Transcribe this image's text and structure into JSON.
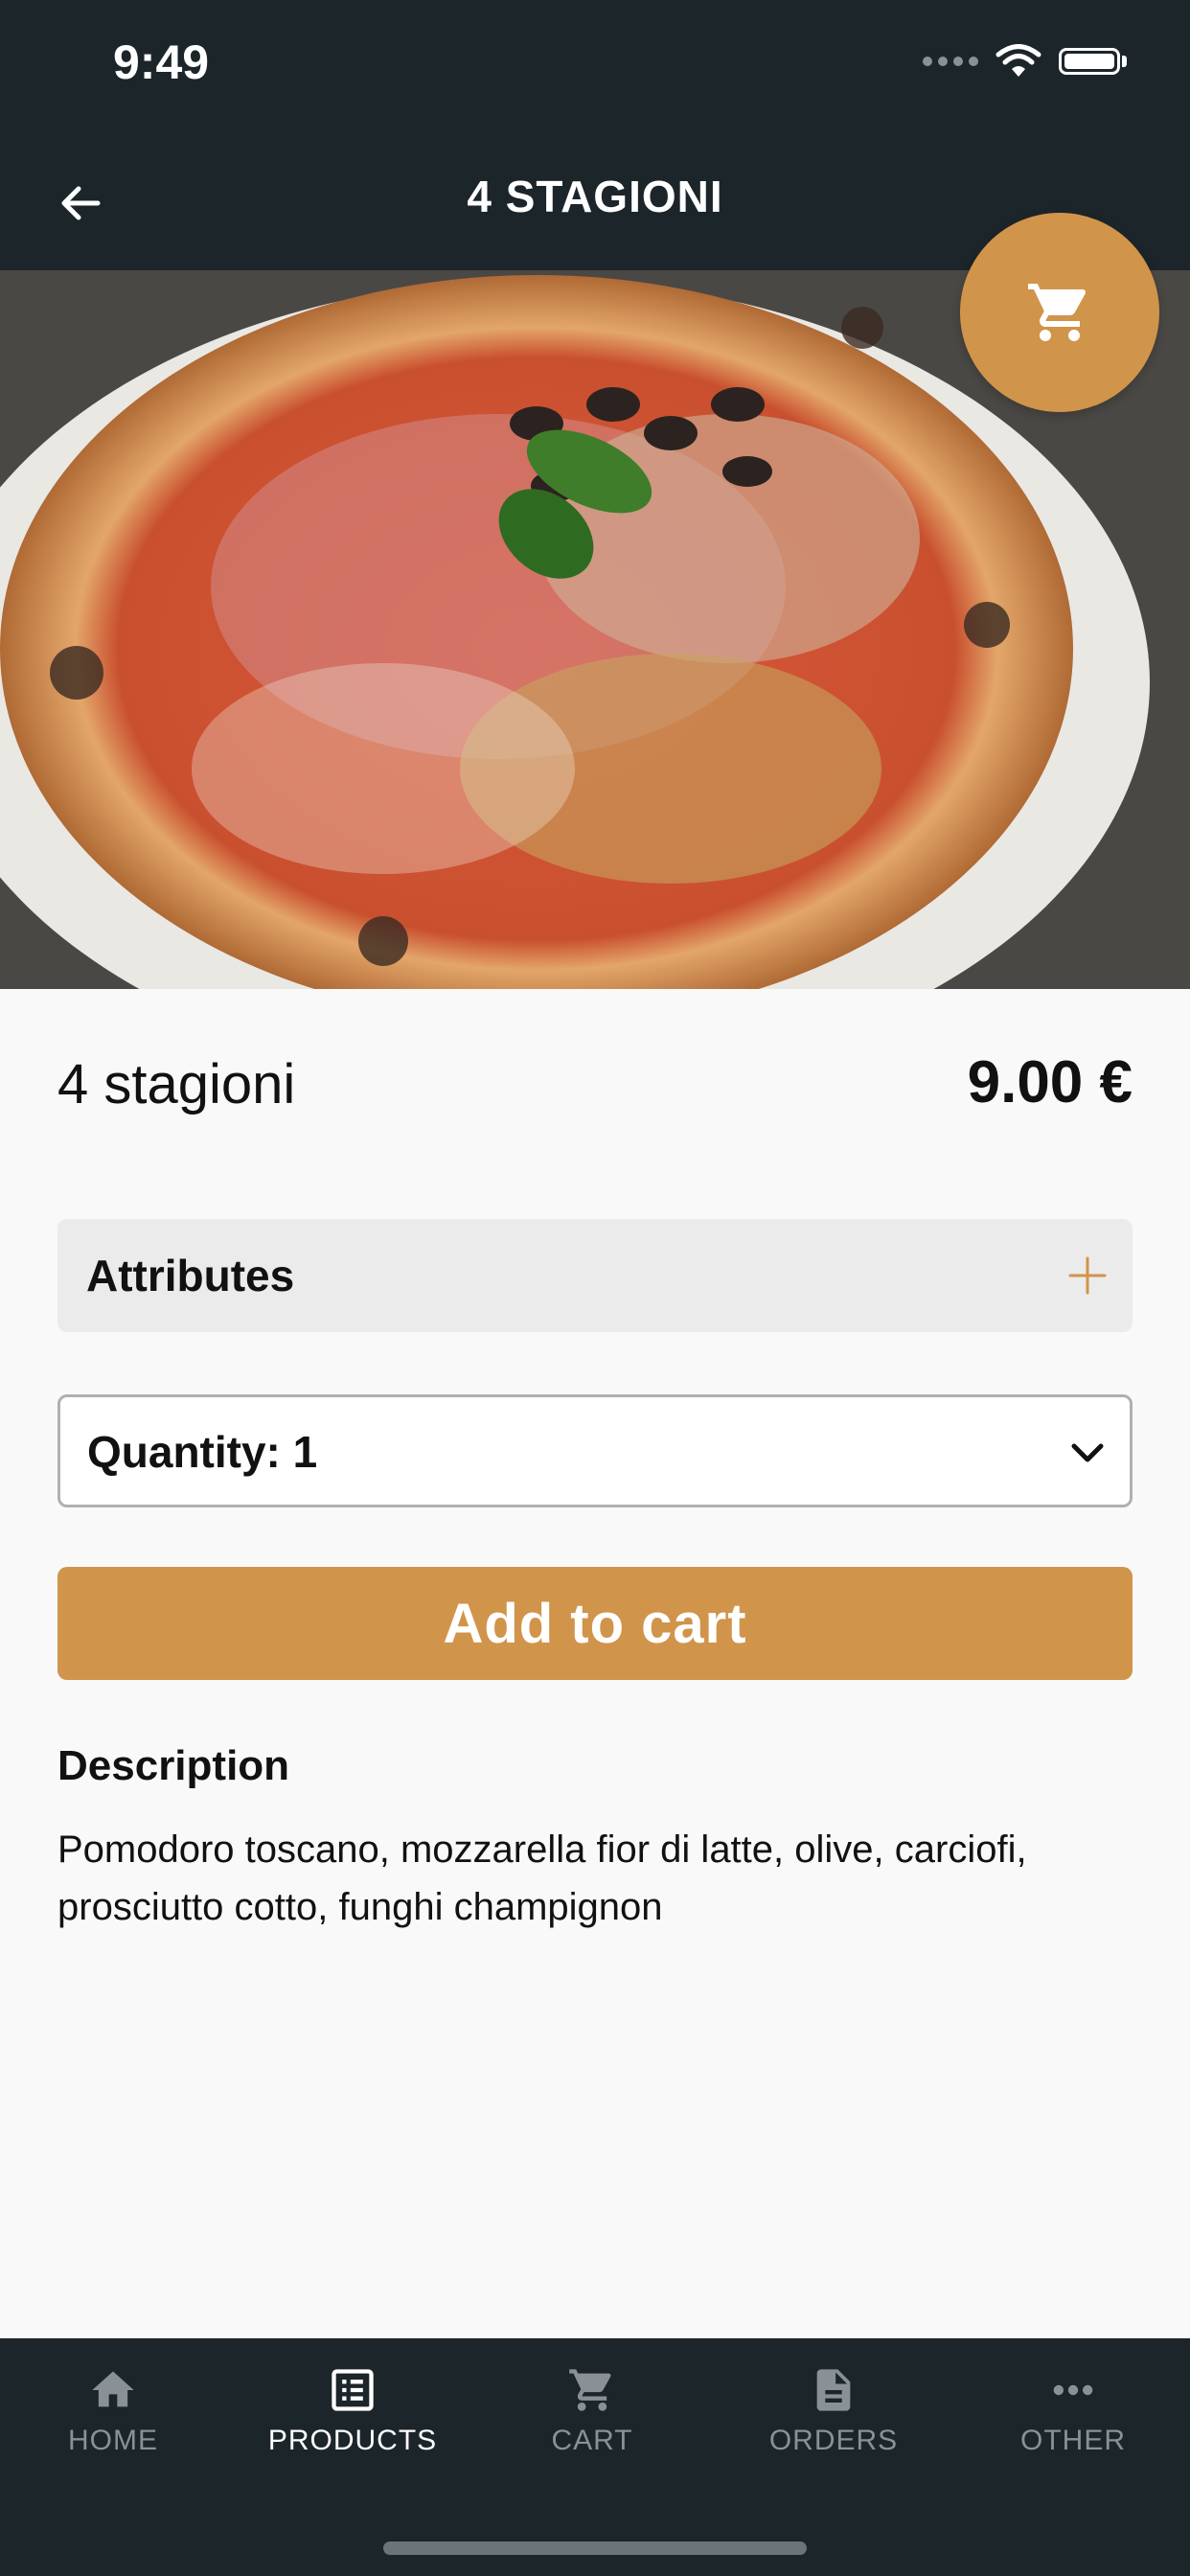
{
  "status_bar": {
    "time": "9:49"
  },
  "header": {
    "title": "4 STAGIONI"
  },
  "hero": {
    "image_desc": "pizza-4-stagioni-photo",
    "page_count": 1,
    "active_page": 1
  },
  "product": {
    "name": "4 stagioni",
    "price": "9.00 €"
  },
  "attributes": {
    "label": "Attributes"
  },
  "quantity": {
    "label": "Quantity: 1"
  },
  "actions": {
    "add_to_cart": "Add to cart"
  },
  "description": {
    "title": "Description",
    "text": "Pomodoro toscano, mozzarella fior di latte, olive, carciofi, prosciutto cotto, funghi champignon"
  },
  "nav": {
    "items": [
      {
        "label": "HOME",
        "icon": "home-icon"
      },
      {
        "label": "PRODUCTS",
        "icon": "list-icon",
        "active": true
      },
      {
        "label": "CART",
        "icon": "cart-icon"
      },
      {
        "label": "ORDERS",
        "icon": "document-icon"
      },
      {
        "label": "OTHER",
        "icon": "more-icon"
      }
    ]
  },
  "colors": {
    "header_bg": "#1c252a",
    "accent": "#d1944b",
    "page_bg": "#f9f9f9"
  }
}
